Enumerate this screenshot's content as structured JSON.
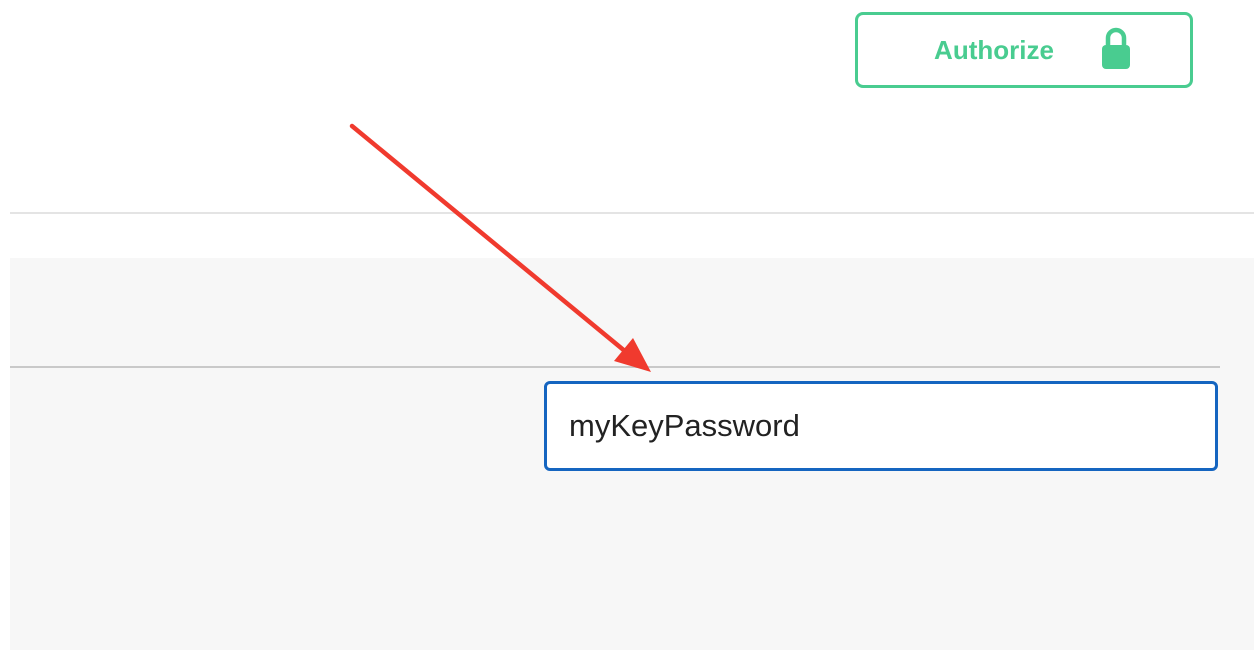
{
  "header": {
    "authorize_label": "Authorize",
    "authorize_icon": "lock-icon",
    "accent_color": "#49cc90"
  },
  "form": {
    "key_password_value": "myKeyPassword",
    "focus_color": "#1565c0"
  },
  "annotation": {
    "arrow_color": "#f03a2e"
  }
}
